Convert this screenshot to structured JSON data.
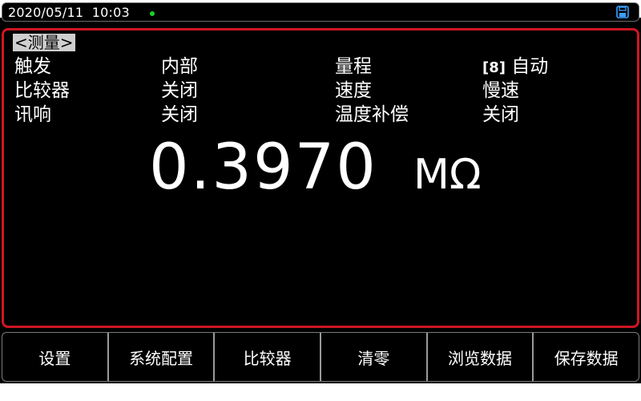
{
  "status": {
    "datetime": "2020/05/11  10:03",
    "indicator_color": "#19d12a",
    "save_icon": "floppy-disk-icon"
  },
  "measure": {
    "mode_tag": "<测量>",
    "params": {
      "trigger_label": "触发",
      "trigger_value": "内部",
      "comparator_label": "比较器",
      "comparator_value": "关闭",
      "beep_label": "讯响",
      "beep_value": "关闭",
      "range_label": "量程",
      "range_index": "[8]",
      "range_value": "自动",
      "speed_label": "速度",
      "speed_value": "慢速",
      "tempcomp_label": "温度补偿",
      "tempcomp_value": "关闭"
    },
    "reading": "0.3970",
    "unit": "MΩ"
  },
  "softkeys": [
    "设置",
    "系统配置",
    "比较器",
    "清零",
    "浏览数据",
    "保存数据"
  ],
  "colors": {
    "frame_accent": "#cf1622",
    "screen_bg": "#000000",
    "text": "#ffffff"
  }
}
